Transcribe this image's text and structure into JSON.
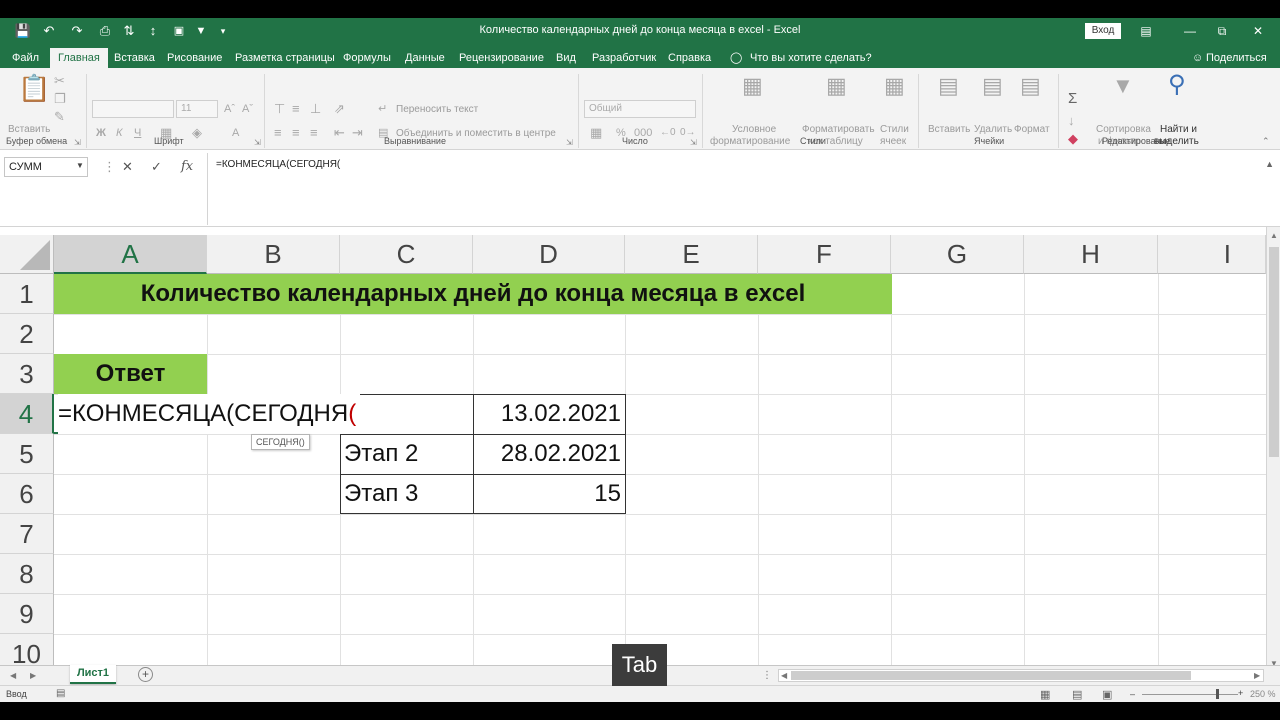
{
  "window": {
    "title": "Количество календарных дней до конца месяца в excel  -  Excel",
    "sign_in": "Вход",
    "qat_more": "▾"
  },
  "menu": {
    "tabs": [
      "Файл",
      "Главная",
      "Вставка",
      "Рисование",
      "Разметка страницы",
      "Формулы",
      "Данные",
      "Рецензирование",
      "Вид",
      "Разработчик",
      "Справка"
    ],
    "tell_me": "Что вы хотите сделать?",
    "share": "Поделиться"
  },
  "ribbon": {
    "clipboard": {
      "paste": "Вставить",
      "label": "Буфер обмена"
    },
    "font": {
      "label": "Шрифт",
      "size": "11",
      "bold": "Ж",
      "italic": "К",
      "underline": "Ч"
    },
    "alignment": {
      "wrap": "Переносить текст",
      "merge": "Объединить и поместить в центре",
      "label": "Выравнивание"
    },
    "number": {
      "format": "Общий",
      "label": "Число"
    },
    "styles": {
      "conditional_1": "Условное",
      "conditional_2": "форматирование",
      "table_1": "Форматировать",
      "table_2": "как таблицу",
      "cell_1": "Стили",
      "cell_2": "ячеек",
      "label": "Стили"
    },
    "cells": {
      "insert": "Вставить",
      "delete": "Удалить",
      "format": "Формат",
      "label": "Ячейки"
    },
    "editing": {
      "sort_1": "Сортировка",
      "sort_2": "и фильтр",
      "find_1": "Найти и",
      "find_2": "выделить",
      "label": "Редактирование"
    }
  },
  "formula_bar": {
    "name_box": "СУММ",
    "cancel": "✕",
    "enter": "✓",
    "fx": "fx",
    "content": "=КОНМЕСЯЦА(СЕГОДНЯ("
  },
  "grid": {
    "columns": [
      "A",
      "B",
      "C",
      "D",
      "E",
      "F",
      "G",
      "H",
      "I"
    ],
    "rows": [
      "1",
      "2",
      "3",
      "4",
      "5",
      "6",
      "7",
      "8",
      "9",
      "10"
    ],
    "selected_column": "A",
    "selected_row": "4"
  },
  "cells": {
    "title": "Количество календарных дней до конца месяца в excel",
    "answer": "Ответ",
    "formula_main": "=КОНМЕСЯЦА(СЕГОДНЯ",
    "formula_paren": "(",
    "tooltip": "СЕГОДНЯ()",
    "c5": "Этап 2",
    "c6": "Этап 3",
    "d4": "13.02.2021",
    "d5": "28.02.2021",
    "d6": "15"
  },
  "sheets": {
    "active": "Лист1"
  },
  "status": {
    "mode": "Ввод",
    "zoom": "250 %"
  },
  "overlay": {
    "key": "Tab"
  },
  "colors": {
    "excel_green": "#217346",
    "band_green": "#92d050"
  }
}
